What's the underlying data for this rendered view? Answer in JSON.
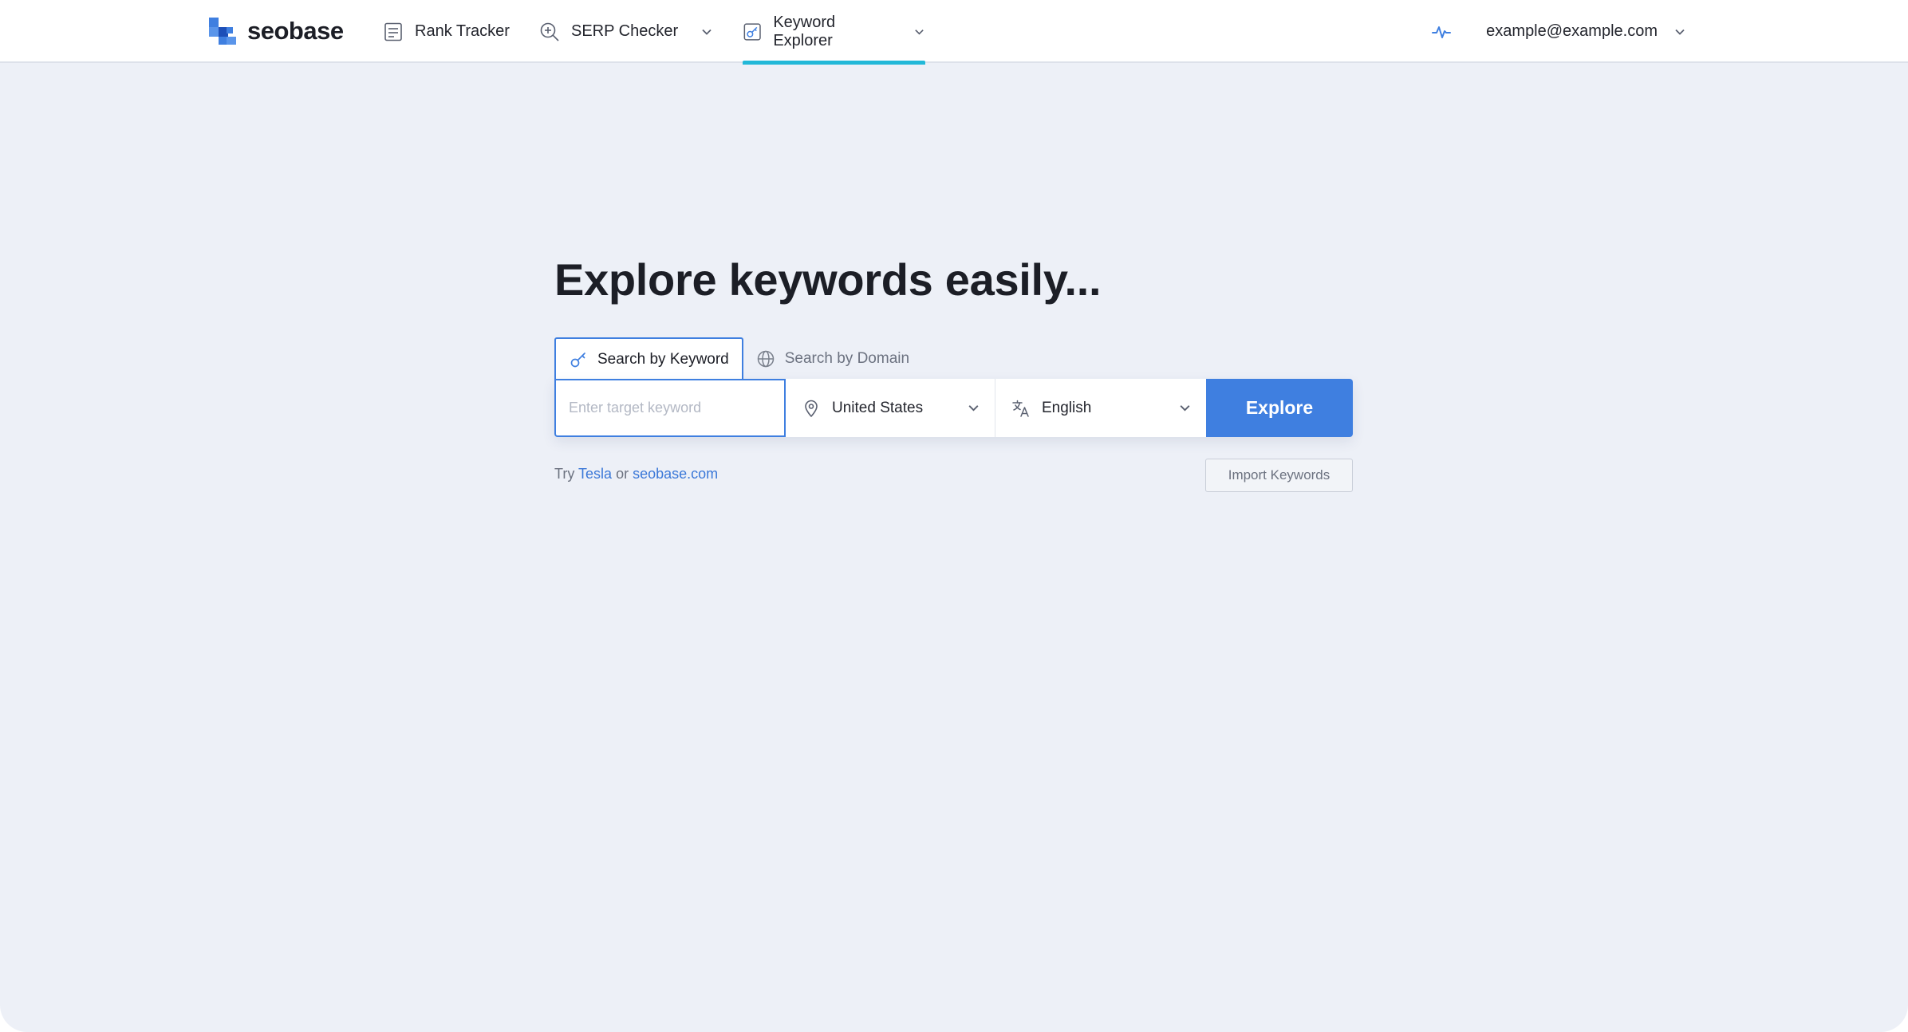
{
  "brand": {
    "name": "seobase"
  },
  "nav": {
    "items": [
      {
        "label": "Rank Tracker",
        "icon": "rank-tracker-icon",
        "active": false,
        "has_dropdown": false
      },
      {
        "label": "SERP Checker",
        "icon": "serp-checker-icon",
        "active": false,
        "has_dropdown": true
      },
      {
        "label": "Keyword Explorer",
        "icon": "keyword-explorer-icon",
        "active": true,
        "has_dropdown": true
      }
    ],
    "account": {
      "email": "example@example.com",
      "icon": "activity-icon"
    }
  },
  "hero": {
    "title": "Explore keywords easily..."
  },
  "tabs": [
    {
      "label": "Search by Keyword",
      "icon": "key-icon",
      "selected": true
    },
    {
      "label": "Search by Domain",
      "icon": "globe-icon",
      "selected": false
    }
  ],
  "search": {
    "keyword_placeholder": "Enter target keyword",
    "keyword_value": "",
    "country": "United States",
    "language": "English",
    "submit_label": "Explore"
  },
  "suggestions": {
    "prefix": "Try",
    "joiner": "or",
    "items": [
      "Tesla",
      "seobase.com"
    ]
  },
  "import_button": {
    "label": "Import Keywords"
  },
  "colors": {
    "accent": "#3f7fe0",
    "active_tab_underline": "#22b8d8",
    "page_background": "#edf0f7",
    "link": "#3b78d8"
  }
}
